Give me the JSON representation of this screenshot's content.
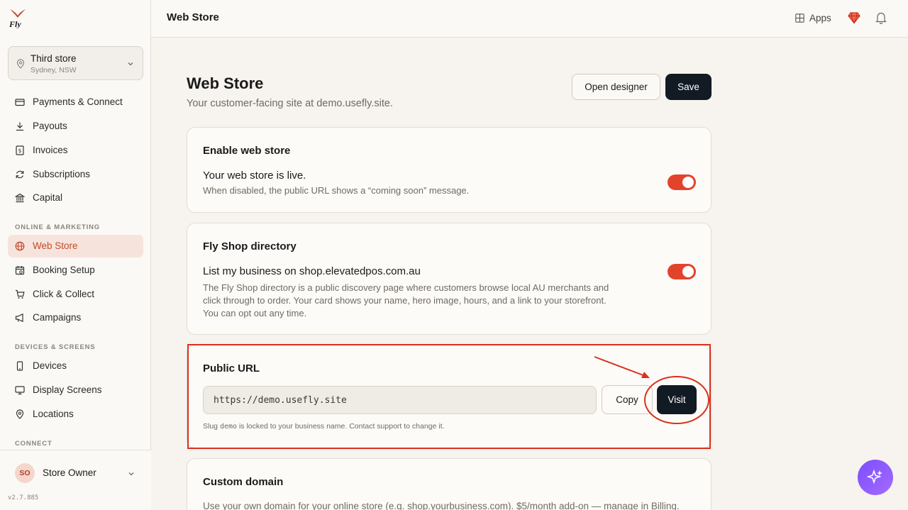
{
  "sidebar": {
    "logo_text": "Fly",
    "store": {
      "name": "Third store",
      "location": "Sydney, NSW"
    },
    "items_top": [
      {
        "label": "Payments & Connect",
        "icon": "card-icon"
      },
      {
        "label": "Payouts",
        "icon": "download-icon"
      },
      {
        "label": "Invoices",
        "icon": "invoice-icon"
      },
      {
        "label": "Subscriptions",
        "icon": "refresh-icon"
      },
      {
        "label": "Capital",
        "icon": "bank-icon"
      }
    ],
    "section_marketing": "ONLINE & MARKETING",
    "items_marketing": [
      {
        "label": "Web Store",
        "icon": "globe-icon",
        "active": true
      },
      {
        "label": "Booking Setup",
        "icon": "calendar-icon"
      },
      {
        "label": "Click & Collect",
        "icon": "cart-icon"
      },
      {
        "label": "Campaigns",
        "icon": "megaphone-icon"
      }
    ],
    "section_devices": "DEVICES & SCREENS",
    "items_devices": [
      {
        "label": "Devices",
        "icon": "phone-icon"
      },
      {
        "label": "Display Screens",
        "icon": "monitor-icon"
      },
      {
        "label": "Locations",
        "icon": "pin-icon"
      }
    ],
    "section_connect": "CONNECT",
    "user": {
      "initials": "SO",
      "name": "Store Owner"
    },
    "version": "v2.7.885"
  },
  "topbar": {
    "title": "Web Store",
    "apps_label": "Apps"
  },
  "main": {
    "title": "Web Store",
    "subtitle": "Your customer-facing site at demo.usefly.site.",
    "open_designer": "Open designer",
    "save": "Save"
  },
  "cards": {
    "enable": {
      "heading": "Enable web store",
      "title": "Your web store is live.",
      "desc": "When disabled, the public URL shows a “coming soon” message.",
      "toggle_on": true
    },
    "directory": {
      "heading": "Fly Shop directory",
      "title": "List my business on shop.elevatedpos.com.au",
      "desc_lines": [
        "The Fly Shop directory is a public discovery page where customers browse local AU merchants and",
        "click through to order. Your card shows your name, hero image, hours, and a link to your storefront.",
        "You can opt out any time."
      ],
      "toggle_on": true
    },
    "public_url": {
      "heading": "Public URL",
      "url": "https://demo.usefly.site",
      "copy": "Copy",
      "visit": "Visit",
      "note_prefix": "Slug ",
      "note_slug": "demo",
      "note_suffix": " is locked to your business name. Contact support to change it."
    },
    "custom_domain": {
      "heading": "Custom domain",
      "desc": "Use your own domain for your online store (e.g. shop.yourbusiness.com). $5/month add-on — manage in Billing."
    }
  },
  "colors": {
    "accent": "#e3432b",
    "dark": "#121a24",
    "annotation": "#d8321f"
  }
}
